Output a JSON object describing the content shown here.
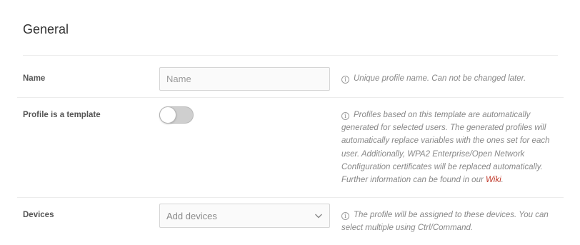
{
  "section": {
    "title": "General"
  },
  "rows": {
    "name": {
      "label": "Name",
      "placeholder": "Name",
      "value": "",
      "help": "Unique profile name. Can not be changed later."
    },
    "template": {
      "label": "Profile is a template",
      "toggle_on": false,
      "help_prefix": "Profiles based on this template are automatically generated for selected users. The generated profiles will automatically replace variables with the ones set for each user. Additionally, WPA2 Enterprise/Open Network Configuration certificates will be replaced automatically. Further information can be found in our",
      "help_link": "Wiki",
      "help_suffix": "."
    },
    "devices": {
      "label": "Devices",
      "placeholder": "Add devices",
      "help": "The profile will be assigned to these devices. You can select multiple using Ctrl/Command."
    }
  },
  "icons": {
    "info": "info-icon",
    "dropdown": "chevron-down-icon",
    "info_glyph": "i"
  },
  "colors": {
    "link": "#c0392b",
    "help_text": "#888888",
    "divider": "#ececec"
  }
}
